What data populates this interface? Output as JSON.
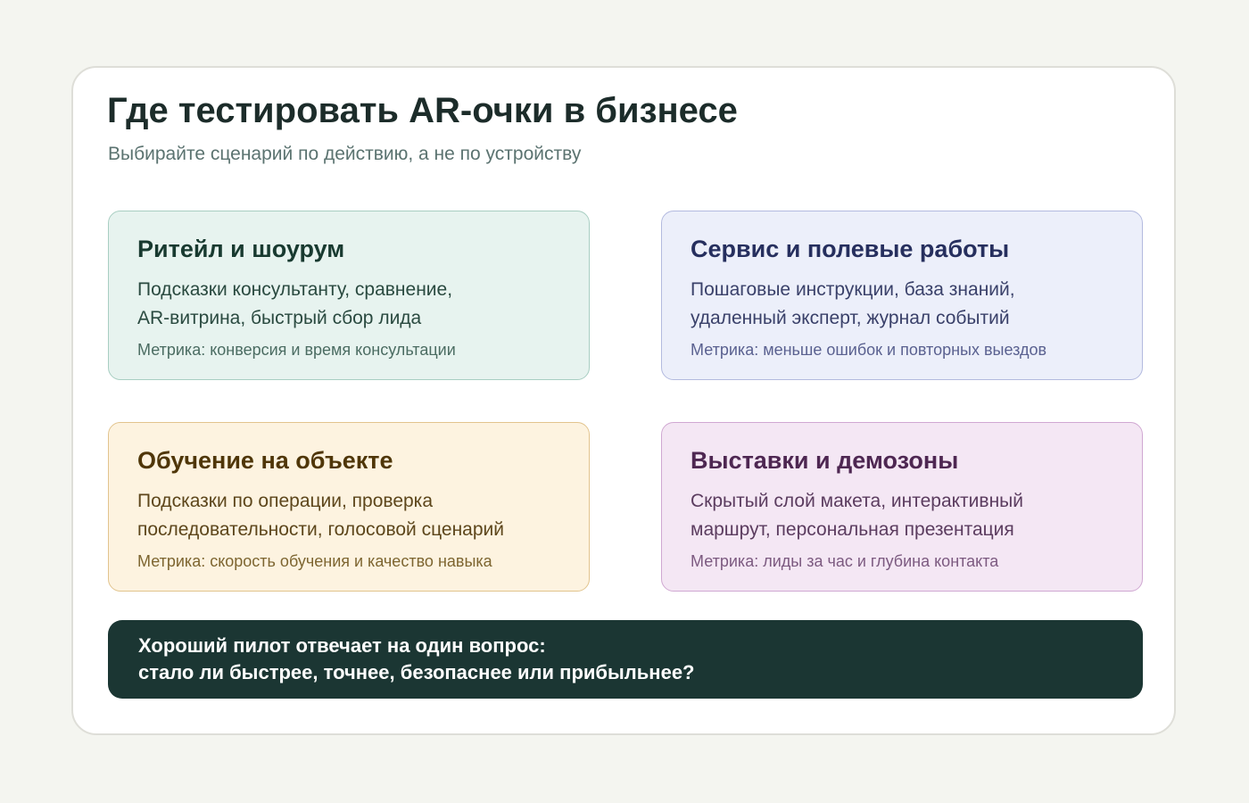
{
  "header": {
    "title": "Где тестировать AR-очки в бизнесе",
    "subtitle": "Выбирайте сценарий по действию, а не по устройству"
  },
  "cards": [
    {
      "title": "Ритейл и шоурум",
      "desc_lines": [
        "Подсказки консультанту, сравнение,",
        "AR-витрина, быстрый сбор лида"
      ],
      "metric": "Метрика: конверсия и время консультации",
      "colors": {
        "background": "#e7f3ef",
        "border": "#a8cec2",
        "title": "#183a30"
      }
    },
    {
      "title": "Сервис и полевые работы",
      "desc_lines": [
        "Пошаговые инструкции, база знаний,",
        "удаленный эксперт, журнал событий"
      ],
      "metric": "Метрика: меньше ошибок и повторных выездов",
      "colors": {
        "background": "#eceffa",
        "border": "#b3badf",
        "title": "#262f5e"
      }
    },
    {
      "title": "Обучение на объекте",
      "desc_lines": [
        "Подсказки по операции, проверка",
        "последовательности, голосовой сценарий"
      ],
      "metric": "Метрика: скорость обучения и качество навыка",
      "colors": {
        "background": "#fdf3e0",
        "border": "#e2c48e",
        "title": "#4f3608"
      }
    },
    {
      "title": "Выставки и демозоны",
      "desc_lines": [
        "Скрытый слой макета, интерактивный",
        "маршрут, персональная презентация"
      ],
      "metric": "Метрика: лиды за час и глубина контакта",
      "colors": {
        "background": "#f4e7f4",
        "border": "#d0a8d2",
        "title": "#4e2752"
      }
    }
  ],
  "banner": {
    "lines": [
      "Хороший пилот отвечает на один вопрос:",
      "стало ли быстрее, точнее, безопаснее или прибыльнее?"
    ],
    "background": "#1b3633"
  }
}
